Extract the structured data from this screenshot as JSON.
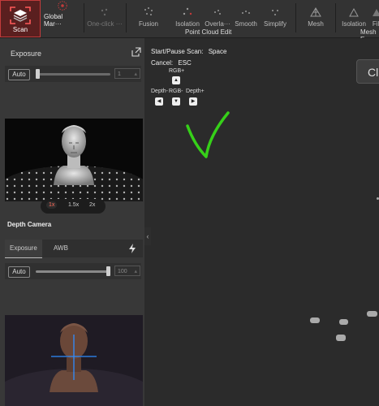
{
  "toolbar": {
    "scan": "Scan",
    "global_markers": "Global Mar···",
    "one_click": "One-click ···",
    "fusion": "Fusion",
    "isolation": "Isolation",
    "overlap": "Overla···",
    "smooth": "Smooth",
    "simplify": "Simplify",
    "mesh": "Mesh",
    "isolation2": "Isolation",
    "fill": "Fill",
    "group_point_cloud": "Point Cloud Edit",
    "group_mesh": "Mesh E"
  },
  "exposure_panel": {
    "title": "Exposure",
    "auto_label": "Auto",
    "value": "1",
    "slider_fraction": 0.02
  },
  "depth_camera": {
    "label": "Depth Camera",
    "zoom_options": [
      "1x",
      "1.5x",
      "2x"
    ],
    "zoom_selected": "1x"
  },
  "rgb_panel": {
    "tabs": [
      "Exposure",
      "AWB"
    ],
    "active_tab": "Exposure",
    "auto_label": "Auto",
    "value": "100",
    "slider_fraction": 1.0
  },
  "hints": {
    "start_pause": "Start/Pause Scan:",
    "start_pause_key": "Space",
    "cancel": "Cancel:",
    "cancel_key": "ESC",
    "rgb_plus": "RGB+",
    "depth_minus": "Depth-",
    "rgb_minus": "RGB-",
    "depth_plus": "Depth+"
  },
  "viewport": {
    "right_button": "Cl"
  },
  "colors": {
    "scan_active": "#c23b3b",
    "checkmark": "#36d019",
    "crosshair": "#2f8cff"
  }
}
